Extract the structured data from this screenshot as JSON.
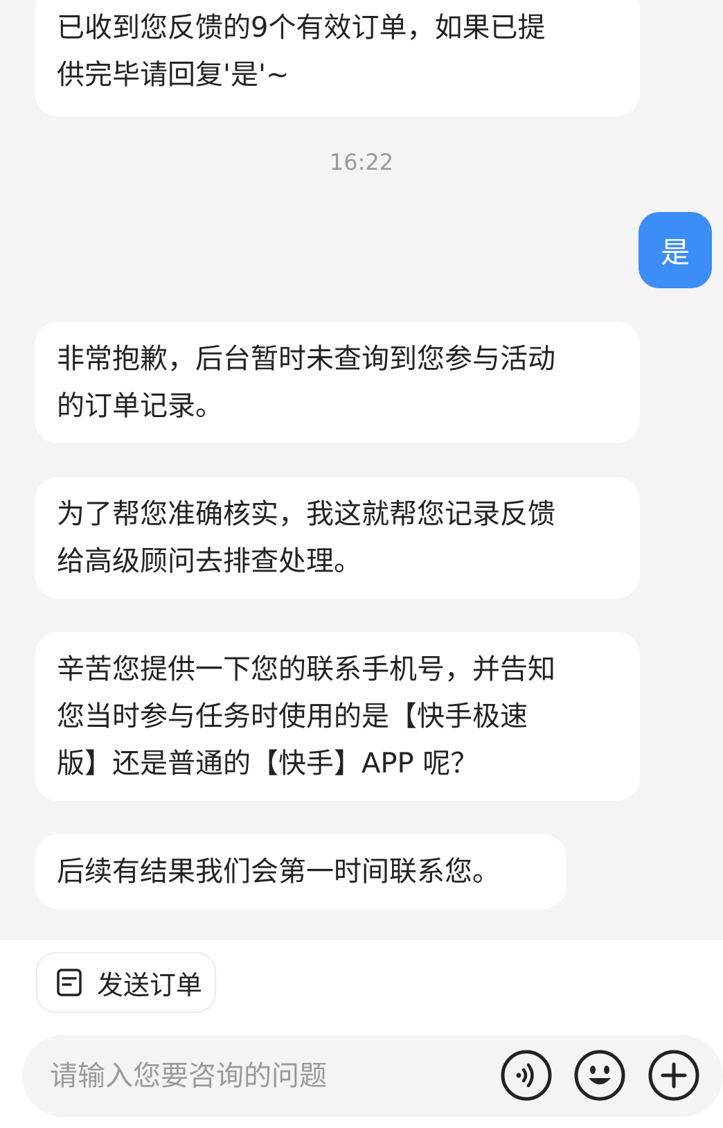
{
  "messages": {
    "m1_line1": "已收到您反馈的9个有效订单，如果已提",
    "m1_line2": "供完毕请回复'是'~",
    "timestamp": "16:22",
    "user_reply": "是",
    "m3_line1": "非常抱歉，后台暂时未查询到您参与活动",
    "m3_line2": "的订单记录。",
    "m4_line1": "为了帮您准确核实，我这就帮您记录反馈",
    "m4_line2": "给高级顾问去排查处理。",
    "m5_line1": "辛苦您提供一下您的联系手机号，并告知",
    "m5_line2": "您当时参与任务时使用的是【快手极速",
    "m5_line3": "版】还是普通的【快手】APP 呢？",
    "m6_line1": "后续有结果我们会第一时间联系您。"
  },
  "quick_actions": {
    "send_order_label": "发送订单",
    "send_order_icon": "document-icon"
  },
  "composer": {
    "placeholder": "请输入您要咨询的问题",
    "voice_icon": "voice-icon",
    "emoji_icon": "emoji-icon",
    "plus_icon": "plus-icon"
  },
  "colors": {
    "user_bubble": "#3c8df5",
    "background": "#f4f4f4",
    "bubble": "#ffffff"
  }
}
